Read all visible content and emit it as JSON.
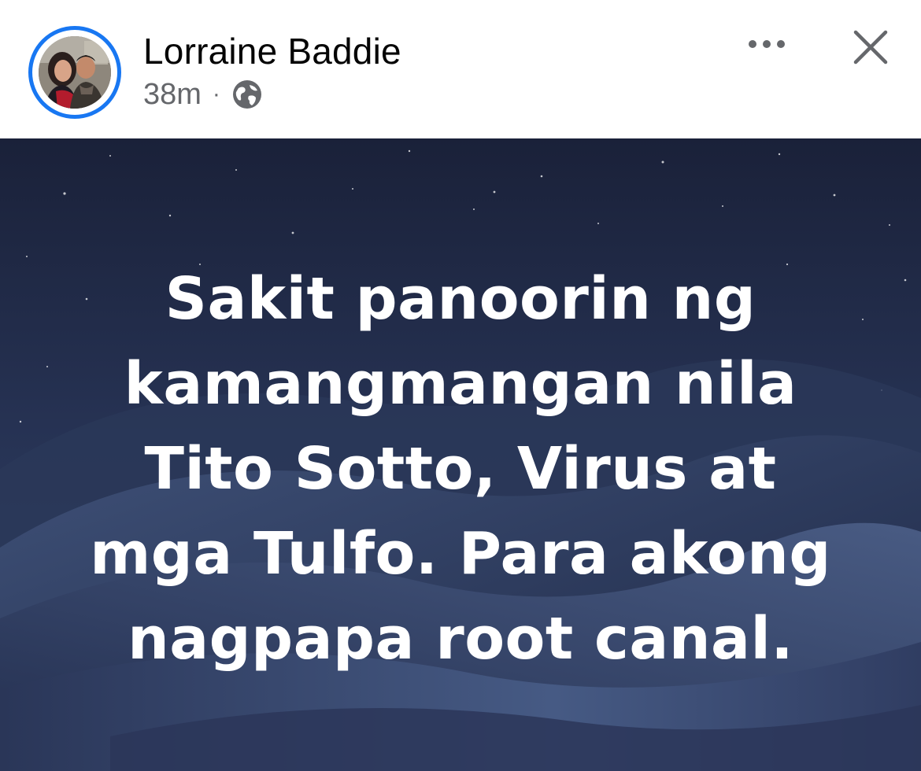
{
  "post": {
    "author_name": "Lorraine Baddie",
    "timestamp": "38m",
    "separator": "·",
    "audience_icon": "globe-icon",
    "more_icon": "more-horizontal-icon",
    "close_icon": "close-icon",
    "text_lines": [
      "Sakit panoorin ng",
      "kamangmangan nila",
      "Tito Sotto, Virus at",
      "mga Tulfo. Para akong",
      "nagpapa root canal."
    ]
  },
  "colors": {
    "avatar_ring": "#1877f2",
    "name_text": "#050505",
    "meta_text": "#65676b",
    "background_sky": "#1f2a47",
    "post_text": "#ffffff"
  }
}
